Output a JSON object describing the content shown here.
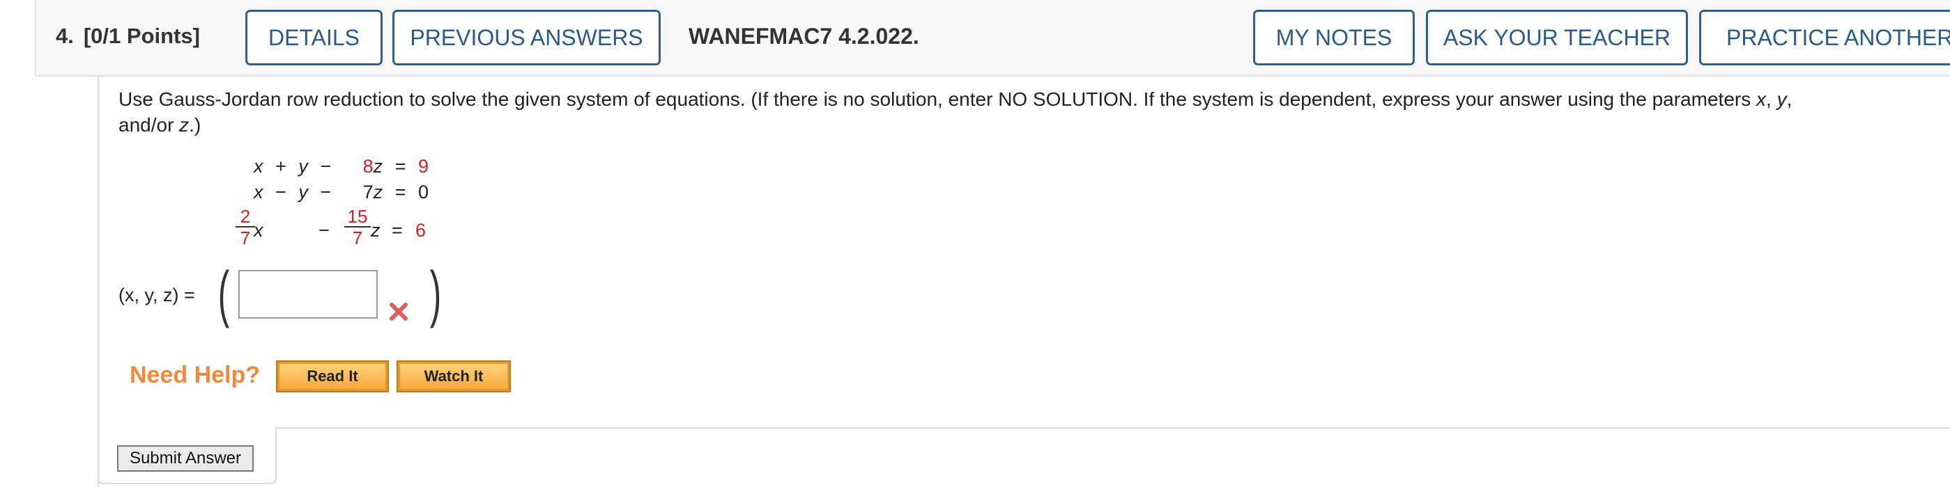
{
  "header": {
    "question_number": "4.",
    "points": "[0/1 Points]",
    "details_label": "DETAILS",
    "previous_answers_label": "PREVIOUS ANSWERS",
    "question_code": "WANEFMAC7 4.2.022.",
    "my_notes_label": "MY NOTES",
    "ask_teacher_label": "ASK YOUR TEACHER",
    "practice_another_label": "PRACTICE ANOTHER"
  },
  "question": {
    "instruction_part1": "Use Gauss-Jordan row reduction to solve the given system of equations. (If there is no solution, enter NO SOLUTION. If the system is dependent, express your answer using the parameters ",
    "param_x": "x",
    "comma1": ", ",
    "param_y": "y",
    "comma2": ",",
    "line2_prefix": "and/or ",
    "param_z": "z",
    "line2_suffix": ".)"
  },
  "equations": {
    "row1": {
      "x": "x",
      "plus": "+",
      "y": "y",
      "minus": "−",
      "coef": "8",
      "z": "z",
      "eq": "=",
      "rhs": "9"
    },
    "row2": {
      "x": "x",
      "minus1": "−",
      "y": "y",
      "minus2": "−",
      "coef": "7",
      "z": "z",
      "eq": "=",
      "rhs": "0"
    },
    "row3": {
      "frac1_num": "2",
      "frac1_den": "7",
      "x": "x",
      "minus": "−",
      "frac2_num": "15",
      "frac2_den": "7",
      "z": "z",
      "eq": "=",
      "rhs": "6"
    }
  },
  "answer": {
    "label": "(x, y, z) =",
    "value": "",
    "status": "incorrect"
  },
  "help": {
    "need_help_label": "Need Help?",
    "read_it_label": "Read It",
    "watch_it_label": "Watch It"
  },
  "submit_label": "Submit Answer",
  "colors": {
    "accent_blue": "#2a5a8a",
    "red_value": "#d61f1f",
    "help_orange": "#f0893a"
  }
}
